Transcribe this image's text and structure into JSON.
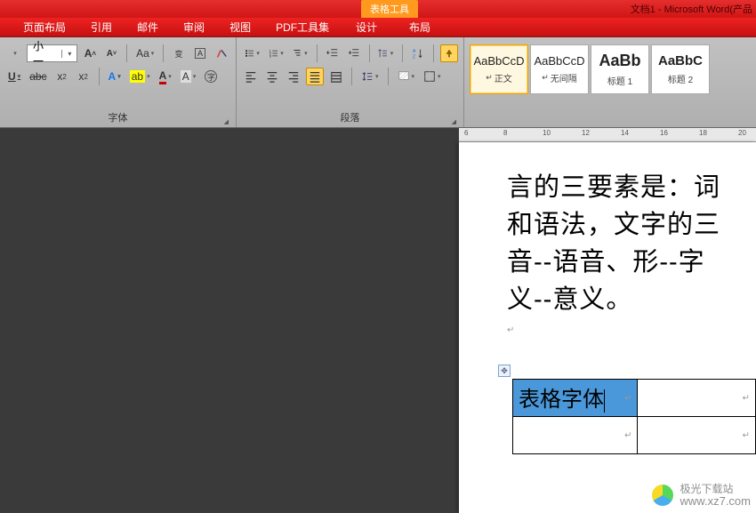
{
  "title_bar": {
    "table_tools": "表格工具",
    "doc_title": "文档1 - Microsoft Word(产品"
  },
  "menu": {
    "tabs": [
      "页面布局",
      "引用",
      "邮件",
      "审阅",
      "视图",
      "PDF工具集"
    ],
    "contextual": [
      "设计",
      "布局"
    ]
  },
  "ribbon": {
    "font": {
      "size_label": "小一",
      "group_label": "字体"
    },
    "paragraph": {
      "group_label": "段落"
    },
    "styles": {
      "items": [
        {
          "sample": "AaBbCcD",
          "label": "正文",
          "big": false
        },
        {
          "sample": "AaBbCcD",
          "label": "无间隔",
          "big": false
        },
        {
          "sample": "AaBb",
          "label": "标题 1",
          "big": true
        },
        {
          "sample": "AaBbC",
          "label": "标题 2",
          "big": true
        }
      ]
    }
  },
  "ruler": {
    "start": 6,
    "nums": [
      6,
      8,
      10,
      12,
      14,
      16,
      18,
      20
    ]
  },
  "document": {
    "lines": [
      "言的三要素是：词",
      "和语法，文字的三",
      "音--语音、形--字",
      "义--意义。"
    ],
    "table_cell_text": "表格字体"
  },
  "watermark": {
    "cn": "极光下载站",
    "url": "www.xz7.com"
  }
}
